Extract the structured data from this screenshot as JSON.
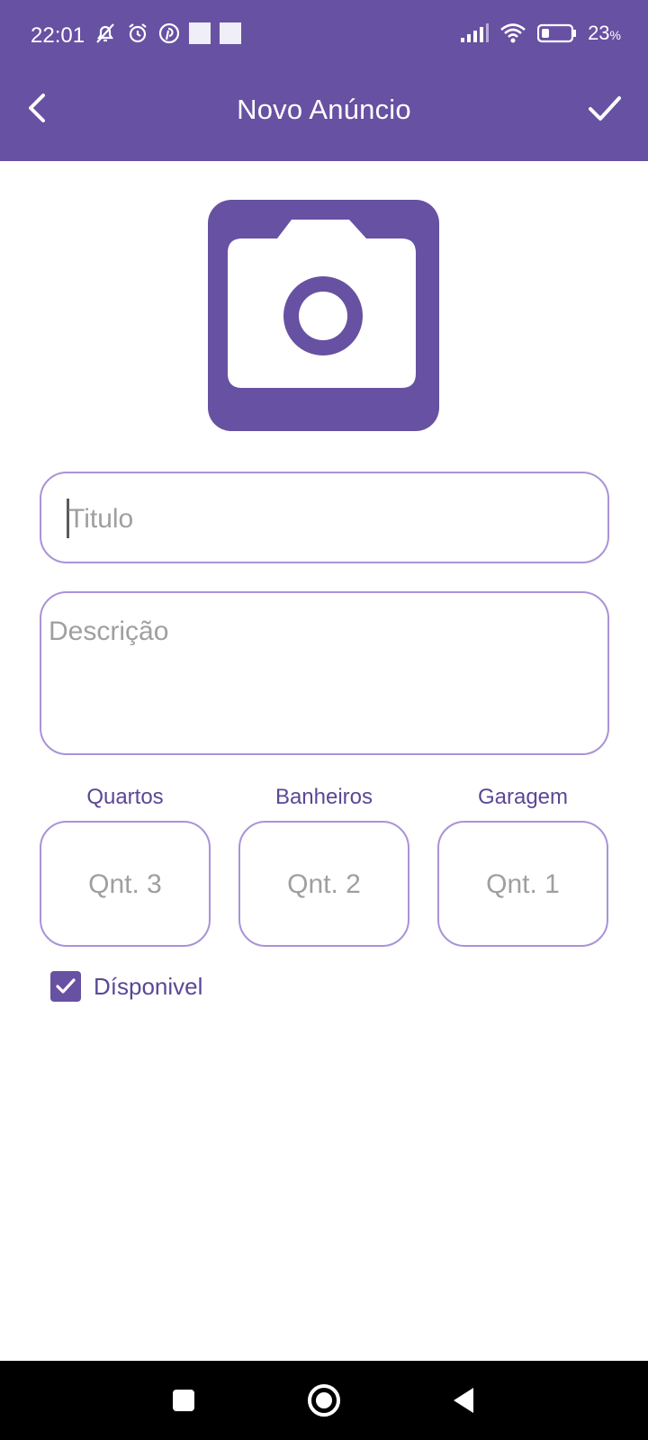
{
  "status_bar": {
    "time": "22:01",
    "battery": "23",
    "battery_unit": "%",
    "icons": [
      "mute-bell-icon",
      "alarm-icon",
      "pinterest-icon",
      "app-square-icon",
      "app-square-icon",
      "signal-icon",
      "wifi-icon",
      "battery-icon"
    ]
  },
  "app_bar": {
    "title": "Novo Anúncio",
    "back_icon": "back-arrow-icon",
    "confirm_icon": "check-icon"
  },
  "photo": {
    "icon": "camera-icon"
  },
  "form": {
    "title_placeholder": "Titulo",
    "description_placeholder": "Descrição",
    "quartos_label": "Quartos",
    "quartos_placeholder": "Qnt. 3",
    "banheiros_label": "Banheiros",
    "banheiros_placeholder": "Qnt. 2",
    "garagem_label": "Garagem",
    "garagem_placeholder": "Qnt. 1",
    "available_label": "Dísponivel",
    "available_checked": true
  },
  "colors": {
    "primary": "#6751a2",
    "border": "#a993d6",
    "label": "#5b4796",
    "placeholder": "#9f9f9f"
  },
  "nav_bar": {
    "buttons": [
      "recents-icon",
      "home-icon",
      "back-icon"
    ]
  }
}
